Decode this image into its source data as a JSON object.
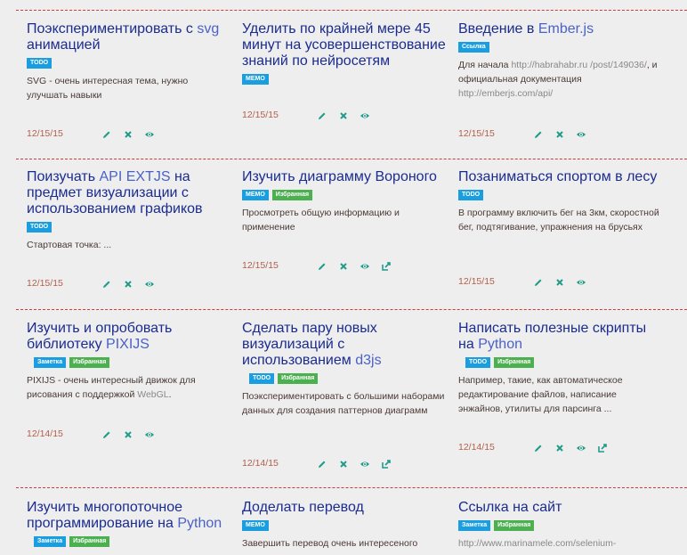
{
  "rows": [
    {
      "cards": [
        {
          "title_pre": "Поэкспериментировать с ",
          "title_hl": "svg",
          "title_post": " анимацией",
          "tags": [
            {
              "label": "TODO",
              "type": "todo"
            }
          ],
          "desc_pre": "SVG - очень интересная тема, нужно улучшать навыки",
          "desc_hl": "",
          "desc_post": "",
          "date": "12/15/15",
          "actions": [
            "edit",
            "delete",
            "view"
          ]
        },
        {
          "title_pre": "Уделить по крайней мере 45 минут на усовершенствование знаний по нейросетям",
          "title_hl": "",
          "title_post": "",
          "tags": [
            {
              "label": "MEMO",
              "type": "memo"
            }
          ],
          "desc_pre": "",
          "desc_hl": "",
          "desc_post": "",
          "date": "12/15/15",
          "actions": [
            "edit",
            "delete",
            "view"
          ]
        },
        {
          "title_pre": "Введение в ",
          "title_hl": "Ember.js",
          "title_post": "",
          "tags": [
            {
              "label": "Ссылка",
              "type": "link"
            }
          ],
          "desc_pre": "Для начала ",
          "desc_hl": "http://habrahabr.ru /post/149036/",
          "desc_post": ", и официальная документация ",
          "desc_hl2": "http://emberjs.com/api/",
          "date": "12/15/15",
          "actions": [
            "edit",
            "delete",
            "view"
          ]
        }
      ]
    },
    {
      "cards": [
        {
          "title_pre": "Поизучать ",
          "title_hl": "API EXTJS",
          "title_post": " на предмет визуализации с использованием графиков",
          "tags": [
            {
              "label": "TODO",
              "type": "todo"
            }
          ],
          "desc_pre": "Стартовая точка: ...",
          "desc_hl": "",
          "desc_post": "",
          "date": "12/15/15",
          "actions": [
            "edit",
            "delete",
            "view"
          ]
        },
        {
          "title_pre": "Изучить диаграмму Вороного",
          "title_hl": "",
          "title_post": "",
          "tags": [
            {
              "label": "MEMO",
              "type": "memo"
            },
            {
              "label": "Избранная",
              "type": "fav"
            }
          ],
          "desc_pre": "Просмотреть общую информацию и применение",
          "desc_hl": "",
          "desc_post": "",
          "date": "12/15/15",
          "actions": [
            "edit",
            "delete",
            "view",
            "share"
          ]
        },
        {
          "title_pre": "Позаниматься спортом в лесу",
          "title_hl": "",
          "title_post": "",
          "tags": [
            {
              "label": "TODO",
              "type": "todo"
            }
          ],
          "desc_pre": "В программу включить бег на 3км, скоростной бег, подтягивание, упражнения на брусьях",
          "desc_hl": "",
          "desc_post": "",
          "date": "12/15/15",
          "actions": [
            "edit",
            "delete",
            "view"
          ]
        }
      ]
    },
    {
      "cards": [
        {
          "title_pre": "Изучить и опробовать библиотеку ",
          "title_hl": "PIXIJS",
          "title_post": "",
          "tags": [
            {
              "label": "Заметка",
              "type": "note"
            },
            {
              "label": "Избранная",
              "type": "fav"
            }
          ],
          "desc_pre": "PIXIJS - очень интересный движок для рисования с поддержкой ",
          "desc_hl": "WebGL",
          "desc_post": ".",
          "date": "12/14/15",
          "actions": [
            "edit",
            "delete",
            "view"
          ]
        },
        {
          "title_pre": "Сделать пару новых визуализаций с использованием ",
          "title_hl": "d3js",
          "title_post": "",
          "tags": [
            {
              "label": "TODO",
              "type": "todo"
            },
            {
              "label": "Избранная",
              "type": "fav"
            }
          ],
          "desc_pre": "Поэкспериментировать с большими наборами данных для создания паттернов диаграмм",
          "desc_hl": "",
          "desc_post": "",
          "date": "12/14/15",
          "actions": [
            "edit",
            "delete",
            "view",
            "share"
          ]
        },
        {
          "title_pre": "Написать полезные скрипты на ",
          "title_hl": "Python",
          "title_post": "",
          "tags": [
            {
              "label": "TODO",
              "type": "todo"
            },
            {
              "label": "Избранная",
              "type": "fav"
            }
          ],
          "desc_pre": "Например, такие, как автоматическое редактирование файлов, написание энжайнов, утилиты для парсинга ...",
          "desc_hl": "",
          "desc_post": "",
          "date": "12/14/15",
          "actions": [
            "edit",
            "delete",
            "view",
            "share"
          ]
        }
      ]
    },
    {
      "cards": [
        {
          "title_pre": "Изучить многопоточное программирование на ",
          "title_hl": "Python",
          "title_post": "",
          "tags": [
            {
              "label": "Заметка",
              "type": "note"
            },
            {
              "label": "Избранная",
              "type": "fav"
            }
          ],
          "desc_pre": "",
          "desc_hl": "",
          "desc_post": "",
          "date": "",
          "actions": []
        },
        {
          "title_pre": "Доделать перевод",
          "title_hl": "",
          "title_post": "",
          "tags": [
            {
              "label": "MEMO",
              "type": "memo"
            }
          ],
          "desc_pre": "Завершить перевод очень интересеного",
          "desc_hl": "",
          "desc_post": "",
          "date": "",
          "actions": []
        },
        {
          "title_pre": "Ссылка на сайт",
          "title_hl": "",
          "title_post": "",
          "tags": [
            {
              "label": "Заметка",
              "type": "note"
            },
            {
              "label": "Избранная",
              "type": "fav"
            }
          ],
          "desc_pre": "",
          "desc_hl": "http://www.marinamele.com/selenium-",
          "desc_post": "",
          "date": "",
          "actions": []
        }
      ]
    }
  ],
  "colors": {
    "title": "#1a2c8f",
    "accent": "#1a9ee0",
    "favorite": "#4caf50",
    "date": "#b35e4a",
    "icon": "#1f9b8a",
    "separator": "#cc3a3a"
  },
  "icons": {
    "edit": "pencil-icon",
    "delete": "close-icon",
    "view": "eye-icon",
    "share": "share-icon"
  }
}
